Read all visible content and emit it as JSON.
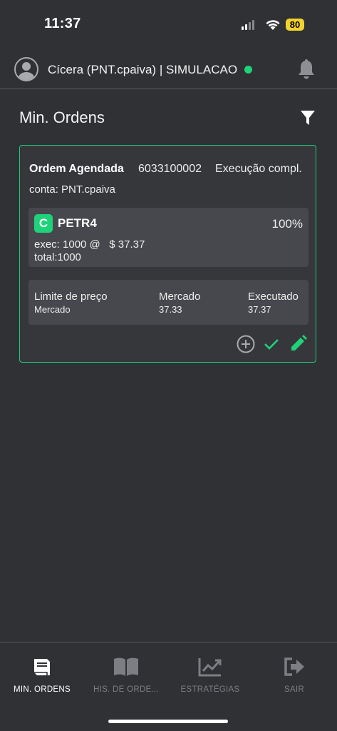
{
  "status_bar": {
    "time": "11:37",
    "battery": "80"
  },
  "header": {
    "user": "Cícera (PNT.cpaiva) | SIMULACAO"
  },
  "page": {
    "title": "Min. Ordens"
  },
  "order": {
    "type": "Ordem Agendada",
    "id": "6033100002",
    "status": "Execução compl.",
    "account": "conta: PNT.cpaiva",
    "asset_badge": "C",
    "asset": "PETR4",
    "percent": "100%",
    "exec": "exec: 1000 @   $ 37.37",
    "total": "total:1000",
    "columns": [
      {
        "label": "Limite de preço",
        "value": "Mercado"
      },
      {
        "label": "Mercado",
        "value": "37.33"
      },
      {
        "label": "Executado",
        "value": "37.37"
      }
    ]
  },
  "nav": {
    "items": [
      {
        "label": "MIN. ORDENS"
      },
      {
        "label": "HIS. DE ORDE..."
      },
      {
        "label": "ESTRATÉGIAS"
      },
      {
        "label": "SAIR"
      }
    ]
  },
  "colors": {
    "background": "#303135",
    "accent": "#1ed27a",
    "battery": "#f2d22e"
  }
}
